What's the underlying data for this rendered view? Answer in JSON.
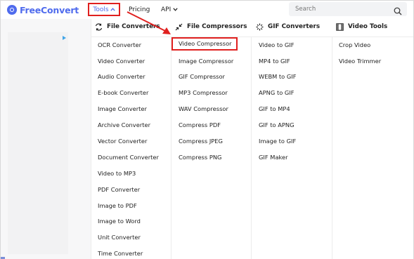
{
  "header": {
    "logo_text": "FreeConvert",
    "nav": {
      "tools_label": "Tools",
      "tools_chevron": "^",
      "pricing_label": "Pricing",
      "api_label": "API",
      "api_chevron": "v"
    },
    "search": {
      "placeholder": "Search"
    }
  },
  "menu": {
    "columns": [
      {
        "title": "File Converters",
        "icon": "swap-arrows-icon",
        "items": [
          "OCR Converter",
          "Video Converter",
          "Audio Converter",
          "E-book Converter",
          "Image Converter",
          "Archive Converter",
          "Vector Converter",
          "Document Converter",
          "Video to MP3",
          "PDF Converter",
          "Image to PDF",
          "Image to Word",
          "Unit Converter",
          "Time Converter"
        ]
      },
      {
        "title": "File Compressors",
        "icon": "compress-arrows-icon",
        "items": [
          "Video Compressor",
          "Image Compressor",
          "GIF Compressor",
          "MP3 Compressor",
          "WAV Compressor",
          "Compress PDF",
          "Compress JPEG",
          "Compress PNG"
        ]
      },
      {
        "title": "GIF Converters",
        "icon": "loading-spinner-icon",
        "items": [
          "Video to GIF",
          "MP4 to GIF",
          "WEBM to GIF",
          "APNG to GIF",
          "GIF to MP4",
          "GIF to APNG",
          "Image to GIF",
          "GIF Maker"
        ]
      },
      {
        "title": "Video Tools",
        "icon": "film-icon",
        "items": [
          "Crop Video",
          "Video Trimmer"
        ]
      }
    ],
    "highlighted_item": "Video Compressor"
  },
  "colors": {
    "brand": "#4f6bed",
    "highlight": "#e0201f",
    "ad_flag": "#41a5e8"
  }
}
